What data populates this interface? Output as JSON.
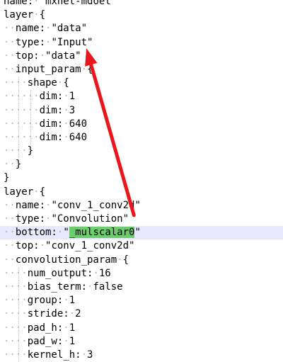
{
  "editor": {
    "highlighted_line": 18,
    "lines": [
      {
        "indent": 0,
        "text": "name: \"mxnet-mdoel\""
      },
      {
        "indent": 0,
        "text": "layer {"
      },
      {
        "indent": 2,
        "text": "name: \"data\""
      },
      {
        "indent": 2,
        "text": "type: \"Input\""
      },
      {
        "indent": 2,
        "text": "top: \"data\""
      },
      {
        "indent": 2,
        "text": "input_param {"
      },
      {
        "indent": 4,
        "text": "shape {"
      },
      {
        "indent": 6,
        "text": "dim: 1"
      },
      {
        "indent": 6,
        "text": "dim: 3"
      },
      {
        "indent": 6,
        "text": "dim: 640"
      },
      {
        "indent": 6,
        "text": "dim: 640"
      },
      {
        "indent": 4,
        "text": "}"
      },
      {
        "indent": 2,
        "text": "}"
      },
      {
        "indent": 0,
        "text": "}"
      },
      {
        "indent": 0,
        "text": "layer {"
      },
      {
        "indent": 2,
        "text": "name: \"conv_1_conv2d\""
      },
      {
        "indent": 2,
        "text": "type: \"Convolution\""
      },
      {
        "indent": 2,
        "text": "bottom: \"",
        "selected": "_mulscalar0",
        "after": "\""
      },
      {
        "indent": 2,
        "text": "top: \"conv_1_conv2d\""
      },
      {
        "indent": 2,
        "text": "convolution_param {"
      },
      {
        "indent": 4,
        "text": "num_output: 16"
      },
      {
        "indent": 4,
        "text": "bias_term: false"
      },
      {
        "indent": 4,
        "text": "group: 1"
      },
      {
        "indent": 4,
        "text": "stride: 2"
      },
      {
        "indent": 4,
        "text": "pad_h: 1"
      },
      {
        "indent": 4,
        "text": "pad_w: 1"
      },
      {
        "indent": 4,
        "text": "kernel_h: 3"
      }
    ]
  },
  "annotation": {
    "color": "#e8171b",
    "from_line": 17,
    "from_column": 10,
    "to_line": 4,
    "to_column": 5
  },
  "colors": {
    "whitespace": "#b4b4b4",
    "selection": "#6ccd6c",
    "current_line": "#e8e8ff"
  }
}
